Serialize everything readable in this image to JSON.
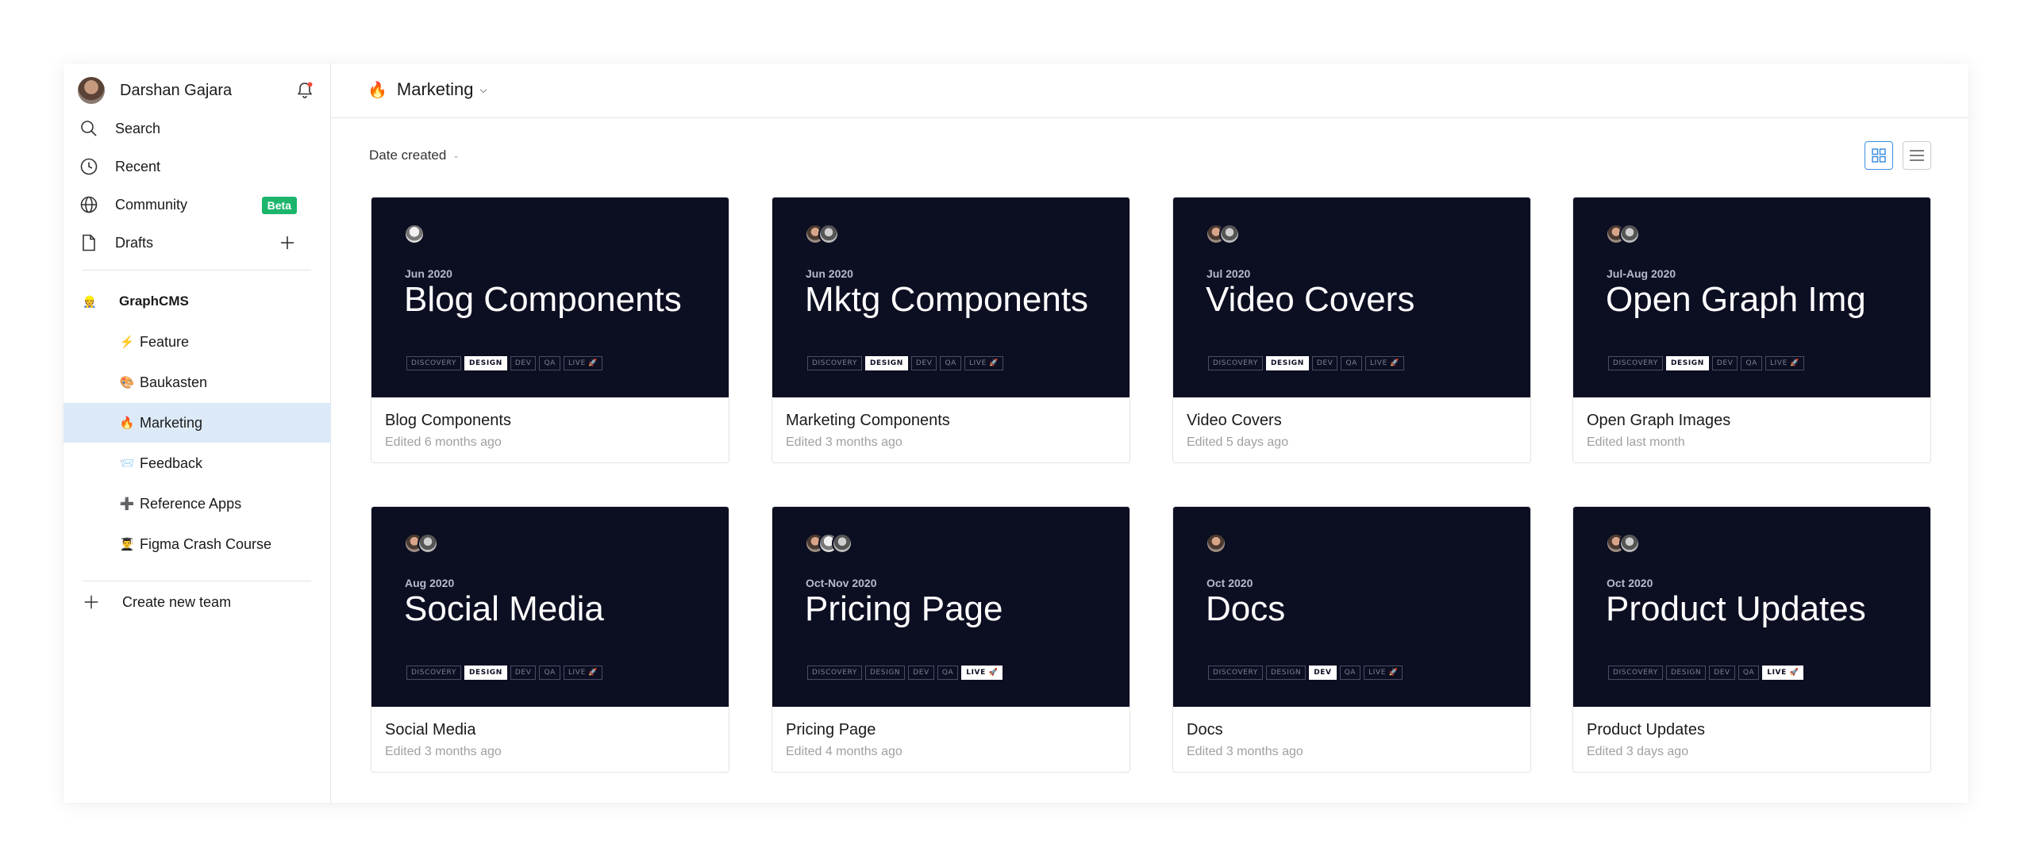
{
  "user": {
    "name": "Darshan Gajara"
  },
  "nav": [
    {
      "label": "Search",
      "icon": "search-icon"
    },
    {
      "label": "Recent",
      "icon": "clock-icon"
    },
    {
      "label": "Community",
      "icon": "globe-icon",
      "badge": "Beta"
    },
    {
      "label": "Drafts",
      "icon": "file-icon"
    }
  ],
  "team": {
    "name": "GraphCMS",
    "emoji": "👷"
  },
  "projects": [
    {
      "label": "Feature",
      "emoji": "⚡"
    },
    {
      "label": "Baukasten",
      "emoji": "🎨"
    },
    {
      "label": "Marketing",
      "emoji": "🔥"
    },
    {
      "label": "Feedback",
      "emoji": "📨"
    },
    {
      "label": "Reference Apps",
      "emoji": "➕"
    },
    {
      "label": "Figma Crash Course",
      "emoji": "👨‍🎓"
    }
  ],
  "create_team": "Create new team",
  "header": {
    "title": "Marketing",
    "emoji": "🔥"
  },
  "sort": {
    "label": "Date created"
  },
  "files": [
    {
      "date": "Jun 2020",
      "cover": "Blog Components",
      "name": "Blog Components",
      "edited": "Edited 6 months ago",
      "active": "DESIGN",
      "avatars": [
        "av3"
      ]
    },
    {
      "date": "Jun 2020",
      "cover": "Mktg Components",
      "name": "Marketing Components",
      "edited": "Edited 3 months ago",
      "active": "DESIGN",
      "avatars": [
        "av1",
        "av2"
      ]
    },
    {
      "date": "Jul 2020",
      "cover": "Video Covers",
      "name": "Video Covers",
      "edited": "Edited 5 days ago",
      "active": "DESIGN",
      "avatars": [
        "av1",
        "av2"
      ]
    },
    {
      "date": "Jul-Aug 2020",
      "cover": "Open Graph Img",
      "name": "Open Graph Images",
      "edited": "Edited last month",
      "active": "DESIGN",
      "avatars": [
        "av1",
        "av2"
      ]
    },
    {
      "date": "Aug 2020",
      "cover": "Social Media",
      "name": "Social Media",
      "edited": "Edited 3 months ago",
      "active": "DESIGN",
      "avatars": [
        "av1",
        "av2"
      ]
    },
    {
      "date": "Oct-Nov 2020",
      "cover": "Pricing Page",
      "name": "Pricing Page",
      "edited": "Edited 4 months ago",
      "active": "LIVE",
      "avatars": [
        "av1",
        "av3",
        "av2"
      ]
    },
    {
      "date": "Oct 2020",
      "cover": "Docs",
      "name": "Docs",
      "edited": "Edited 3 months ago",
      "active": "DEV",
      "avatars": [
        "av1"
      ]
    },
    {
      "date": "Oct 2020",
      "cover": "Product Updates",
      "name": "Product Updates",
      "edited": "Edited 3 days ago",
      "active": "LIVE",
      "avatars": [
        "av1",
        "av2"
      ]
    }
  ],
  "tags": [
    "DISCOVERY",
    "DESIGN",
    "DEV",
    "QA",
    "LIVE 🚀"
  ]
}
